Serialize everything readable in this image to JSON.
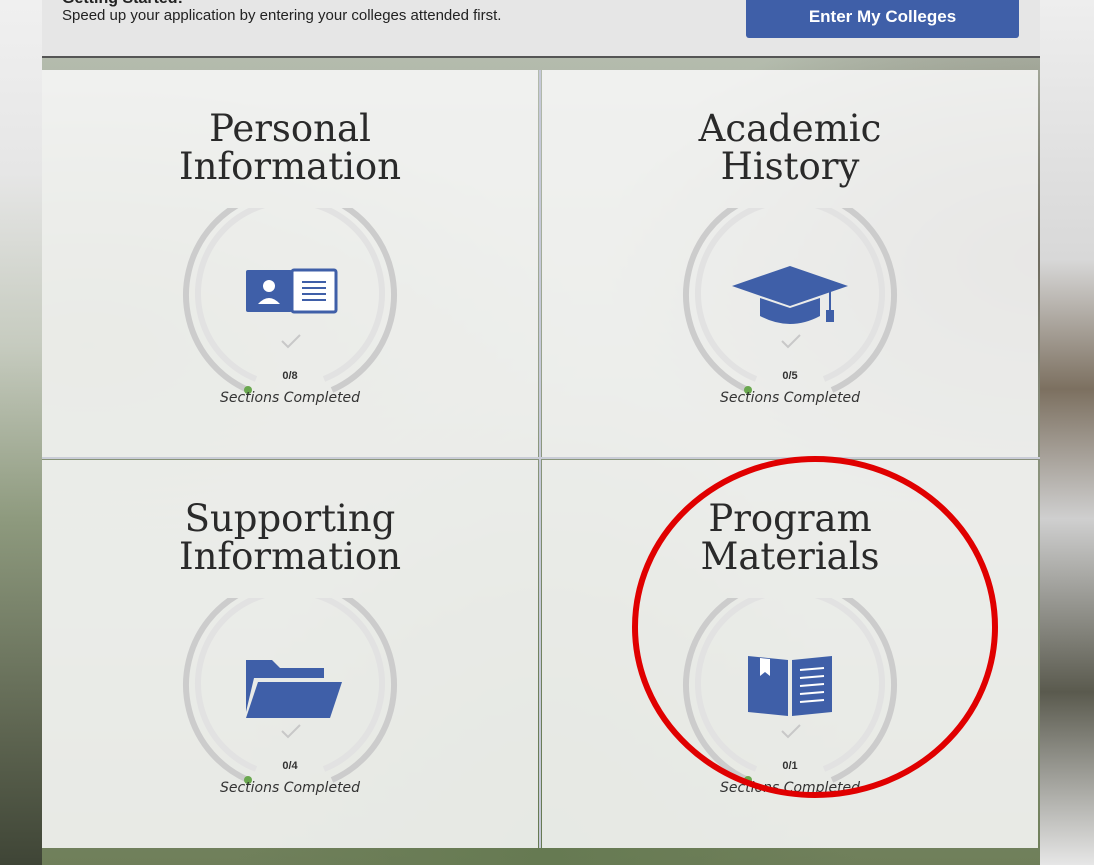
{
  "header": {
    "getting_started": "Getting Started:",
    "description": "Speed up your application by entering your colleges attended first.",
    "button_label": "Enter My Colleges"
  },
  "tiles": [
    {
      "title_line1": "Personal",
      "title_line2": "Information",
      "count": "0/8",
      "caption": "Sections Completed",
      "icon": "id-card-icon",
      "progress": 0
    },
    {
      "title_line1": "Academic",
      "title_line2": "History",
      "count": "0/5",
      "caption": "Sections Completed",
      "icon": "graduation-cap-icon",
      "progress": 0
    },
    {
      "title_line1": "Supporting",
      "title_line2": "Information",
      "count": "0/4",
      "caption": "Sections Completed",
      "icon": "folder-icon",
      "progress": 0
    },
    {
      "title_line1": "Program",
      "title_line2": "Materials",
      "count": "0/1",
      "caption": "Sections Completed",
      "icon": "open-book-icon",
      "progress": 0
    }
  ],
  "colors": {
    "accent": "#3f5fa8",
    "progress_dot": "#6aa84f",
    "ring": "#cccccc",
    "highlight": "#e00000"
  }
}
